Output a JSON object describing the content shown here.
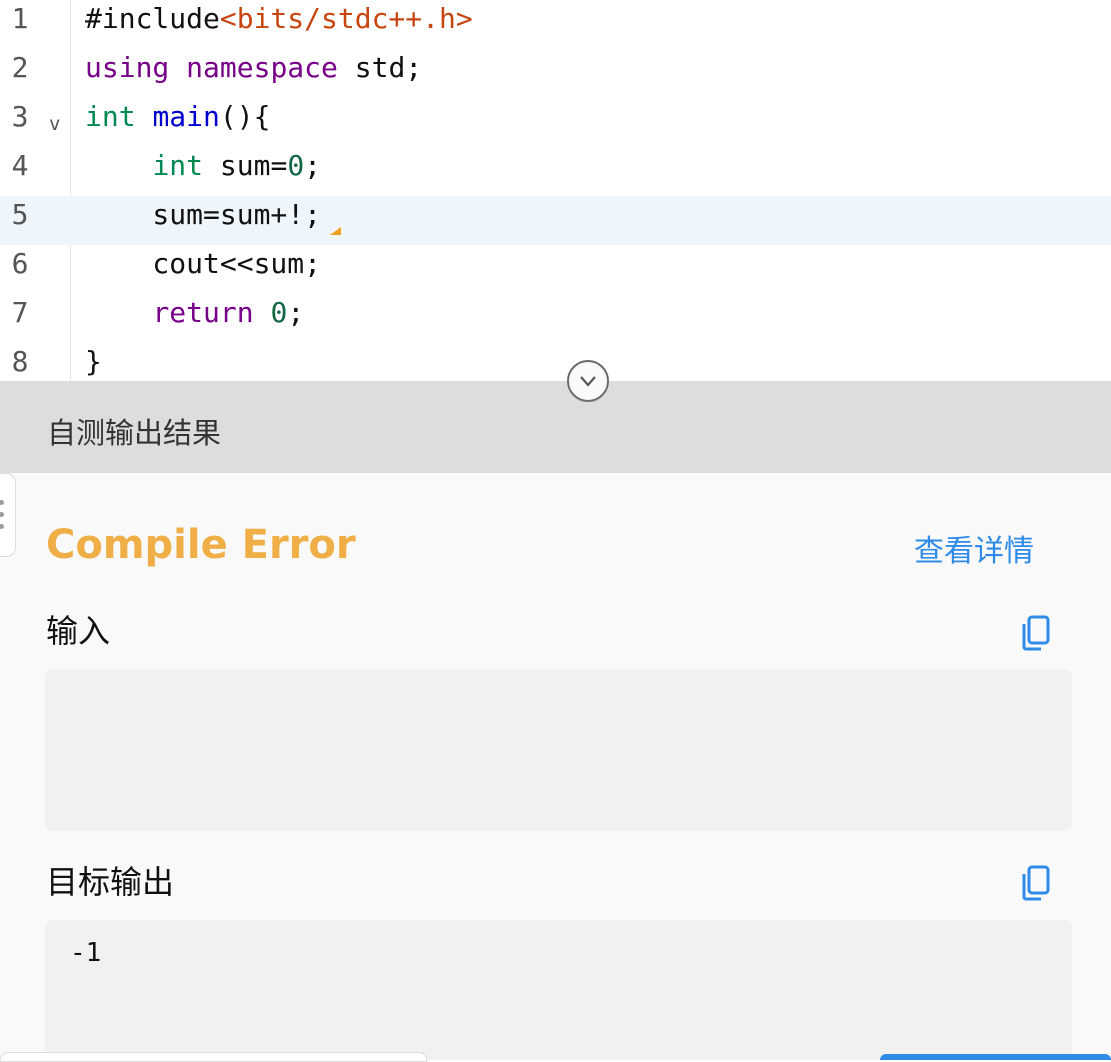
{
  "editor": {
    "lines": [
      {
        "num": "1",
        "tokens": [
          {
            "t": "#include",
            "c": "plain"
          },
          {
            "t": "<bits/stdc++.h>",
            "c": "inc"
          }
        ]
      },
      {
        "num": "2",
        "tokens": [
          {
            "t": "using",
            "c": "kw"
          },
          {
            "t": " ",
            "c": "plain"
          },
          {
            "t": "namespace",
            "c": "kw"
          },
          {
            "t": " std;",
            "c": "plain"
          }
        ]
      },
      {
        "num": "3",
        "fold": "v",
        "tokens": [
          {
            "t": "int",
            "c": "type"
          },
          {
            "t": " ",
            "c": "plain"
          },
          {
            "t": "main",
            "c": "fn"
          },
          {
            "t": "(){",
            "c": "plain"
          }
        ]
      },
      {
        "num": "4",
        "tokens": [
          {
            "t": "    ",
            "c": "plain"
          },
          {
            "t": "int",
            "c": "type"
          },
          {
            "t": " sum=",
            "c": "plain"
          },
          {
            "t": "0",
            "c": "num"
          },
          {
            "t": ";",
            "c": "plain"
          }
        ]
      },
      {
        "num": "5",
        "active": true,
        "tokens": [
          {
            "t": "    sum=sum+!;",
            "c": "plain"
          }
        ]
      },
      {
        "num": "6",
        "tokens": [
          {
            "t": "    cout<<sum;",
            "c": "plain"
          }
        ]
      },
      {
        "num": "7",
        "tokens": [
          {
            "t": "    ",
            "c": "plain"
          },
          {
            "t": "return",
            "c": "kw"
          },
          {
            "t": " ",
            "c": "plain"
          },
          {
            "t": "0",
            "c": "num"
          },
          {
            "t": ";",
            "c": "plain"
          }
        ]
      },
      {
        "num": "8",
        "tokens": [
          {
            "t": "}",
            "c": "plain"
          }
        ]
      }
    ],
    "collapse_icon": "chevron-down-circle-icon"
  },
  "result_panel": {
    "title": "自测输出结果",
    "status": "Compile Error",
    "status_color": "#efae46",
    "detail_link": "查看详情",
    "input_label": "输入",
    "input_value": "",
    "expected_label": "目标输出",
    "expected_value": "-1",
    "copy_icon": "copy-icon",
    "accent_color": "#2f8be8"
  }
}
